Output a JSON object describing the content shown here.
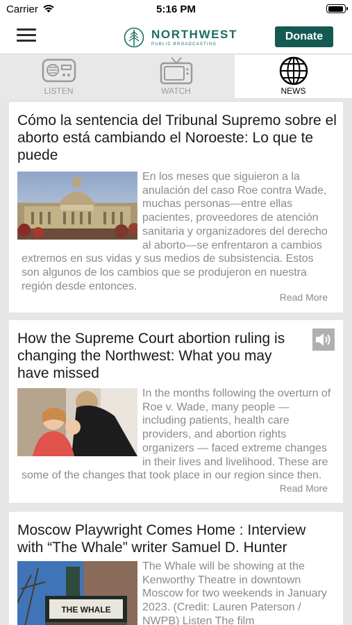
{
  "status_bar": {
    "carrier": "Carrier",
    "time": "5:16 PM"
  },
  "header": {
    "logo_name": "NORTHWEST",
    "logo_subtitle": "PUBLIC BROADCASTING",
    "donate_label": "Donate",
    "brand_color": "#145a52"
  },
  "tabs": [
    {
      "label": "LISTEN",
      "icon": "radio-icon",
      "active": false
    },
    {
      "label": "WATCH",
      "icon": "tv-icon",
      "active": false
    },
    {
      "label": "NEWS",
      "icon": "globe-icon",
      "active": true
    }
  ],
  "articles": [
    {
      "title": "Cómo la sentencia del Tribunal Supremo sobre el aborto está cambiando el Noroeste: Lo que te puede",
      "summary": "En los meses que siguieron a la anulación del caso Roe contra Wade, muchas personas—entre ellas pacientes, proveedores de atención sanitaria y organizadores del derecho al aborto—se enfrentaron a cambios extremos en sus vidas y sus medios de subsistencia. Estos son algunos de los cambios que se produjeron en nuestra región desde entonces.",
      "read_more": "Read More",
      "has_audio": false
    },
    {
      "title": "How the Supreme Court abortion ruling is changing the Northwest: What you may have missed",
      "summary": "In the months following the overturn of Roe v. Wade, many people — including patients, health care providers, and abortion rights organizers — faced extreme changes in their lives and livelihood. These are some of the changes that took place in our region since then.",
      "read_more": "Read More",
      "has_audio": true
    },
    {
      "title": "Moscow Playwright Comes Home : Interview with “The Whale” writer Samuel D. Hunter",
      "summary": "The Whale will be showing at the Kenworthy Theatre in downtown Moscow for two weekends in January 2023. (Credit: Lauren Paterson / NWPB) Listen The film",
      "marquee_text": "THE WHALE",
      "has_audio": false
    }
  ]
}
